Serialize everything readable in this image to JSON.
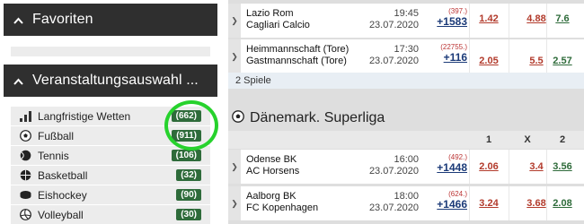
{
  "sidebar": {
    "favorites_title": "Favoriten",
    "events_title": "Veranstaltungsauswahl ...",
    "sports": [
      {
        "label": "Langfristige Wetten",
        "count": "(662)",
        "icon": "bar-chart-icon"
      },
      {
        "label": "Fußball",
        "count": "(911)",
        "icon": "soccer-ball-icon"
      },
      {
        "label": "Tennis",
        "count": "(106)",
        "icon": "tennis-ball-icon"
      },
      {
        "label": "Basketball",
        "count": "(32)",
        "icon": "basketball-icon"
      },
      {
        "label": "Eishockey",
        "count": "(90)",
        "icon": "ice-hockey-icon"
      },
      {
        "label": "Volleyball",
        "count": "(30)",
        "icon": "volleyball-icon"
      }
    ],
    "highlight_color": "#27d22d"
  },
  "matches_top": [
    {
      "home": "Lazio Rom",
      "away": "Cagliari Calcio",
      "time": "19:45",
      "date": "23.07.2020",
      "small": "(397.)",
      "big": "+1583",
      "o1": "1.42",
      "ox": "4.88",
      "o2": "7.6"
    },
    {
      "home": "Heimmannschaft (Tore)",
      "away": "Gastmannschaft (Tore)",
      "time": "17:30",
      "date": "23.07.2020",
      "small": "(22755.)",
      "big": "+116",
      "o1": "2.05",
      "ox": "5.5",
      "o2": "2.57"
    }
  ],
  "spiele_label": "2 Spiele",
  "league": {
    "title": "Dänemark. Superliga",
    "col1": "1",
    "colx": "X",
    "col2": "2"
  },
  "matches_bottom": [
    {
      "home": "Odense BK",
      "away": "AC Horsens",
      "time": "16:00",
      "date": "23.07.2020",
      "small": "(492.)",
      "big": "+1448",
      "o1": "2.06",
      "ox": "3.4",
      "o2": "3.56"
    },
    {
      "home": "Aalborg BK",
      "away": "FC Kopenhagen",
      "time": "18:00",
      "date": "23.07.2020",
      "small": "(624.)",
      "big": "+1466",
      "o1": "3.24",
      "ox": "3.68",
      "o2": "2.08"
    }
  ],
  "colors": {
    "header_dark": "#2f2f2f",
    "count_badge": "#2e6b3a",
    "odds_red": "#b23a2b",
    "odds_green": "#2e6b3a",
    "link_blue": "#1b3a78"
  }
}
